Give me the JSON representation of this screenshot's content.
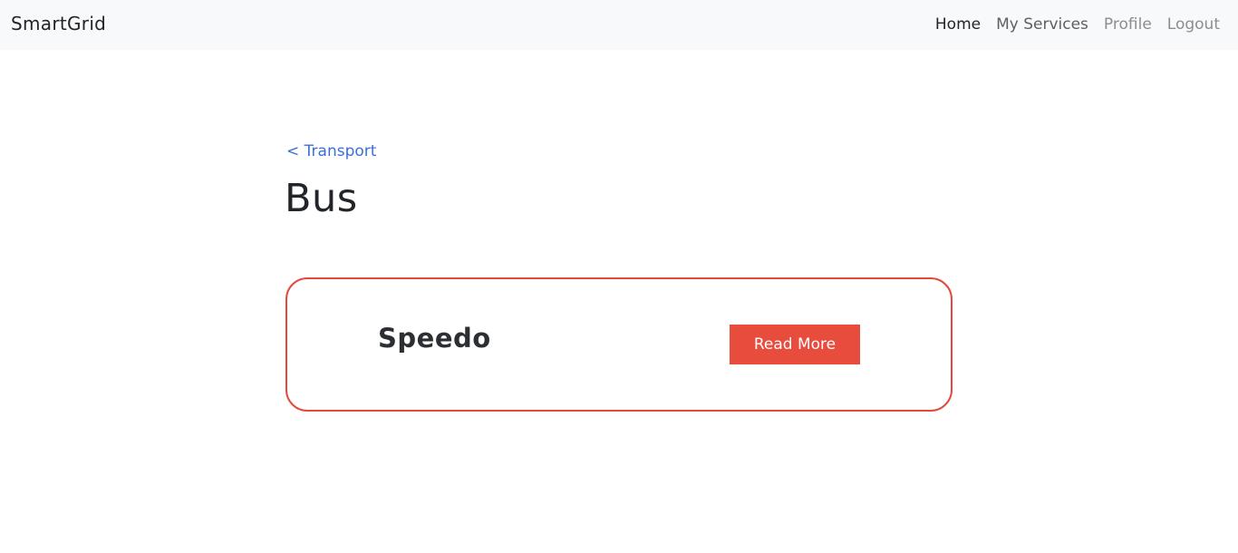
{
  "navbar": {
    "brand": "SmartGrid",
    "links": [
      {
        "label": "Home"
      },
      {
        "label": "My Services"
      },
      {
        "label": "Profile"
      },
      {
        "label": "Logout"
      }
    ]
  },
  "main": {
    "breadcrumb": "< Transport",
    "title": "Bus",
    "cards": [
      {
        "title": "Speedo",
        "button_label": "Read More"
      }
    ]
  },
  "colors": {
    "navbar_bg": "#f8f9fa",
    "accent": "#e84c3d",
    "link": "#3b6fd9"
  }
}
